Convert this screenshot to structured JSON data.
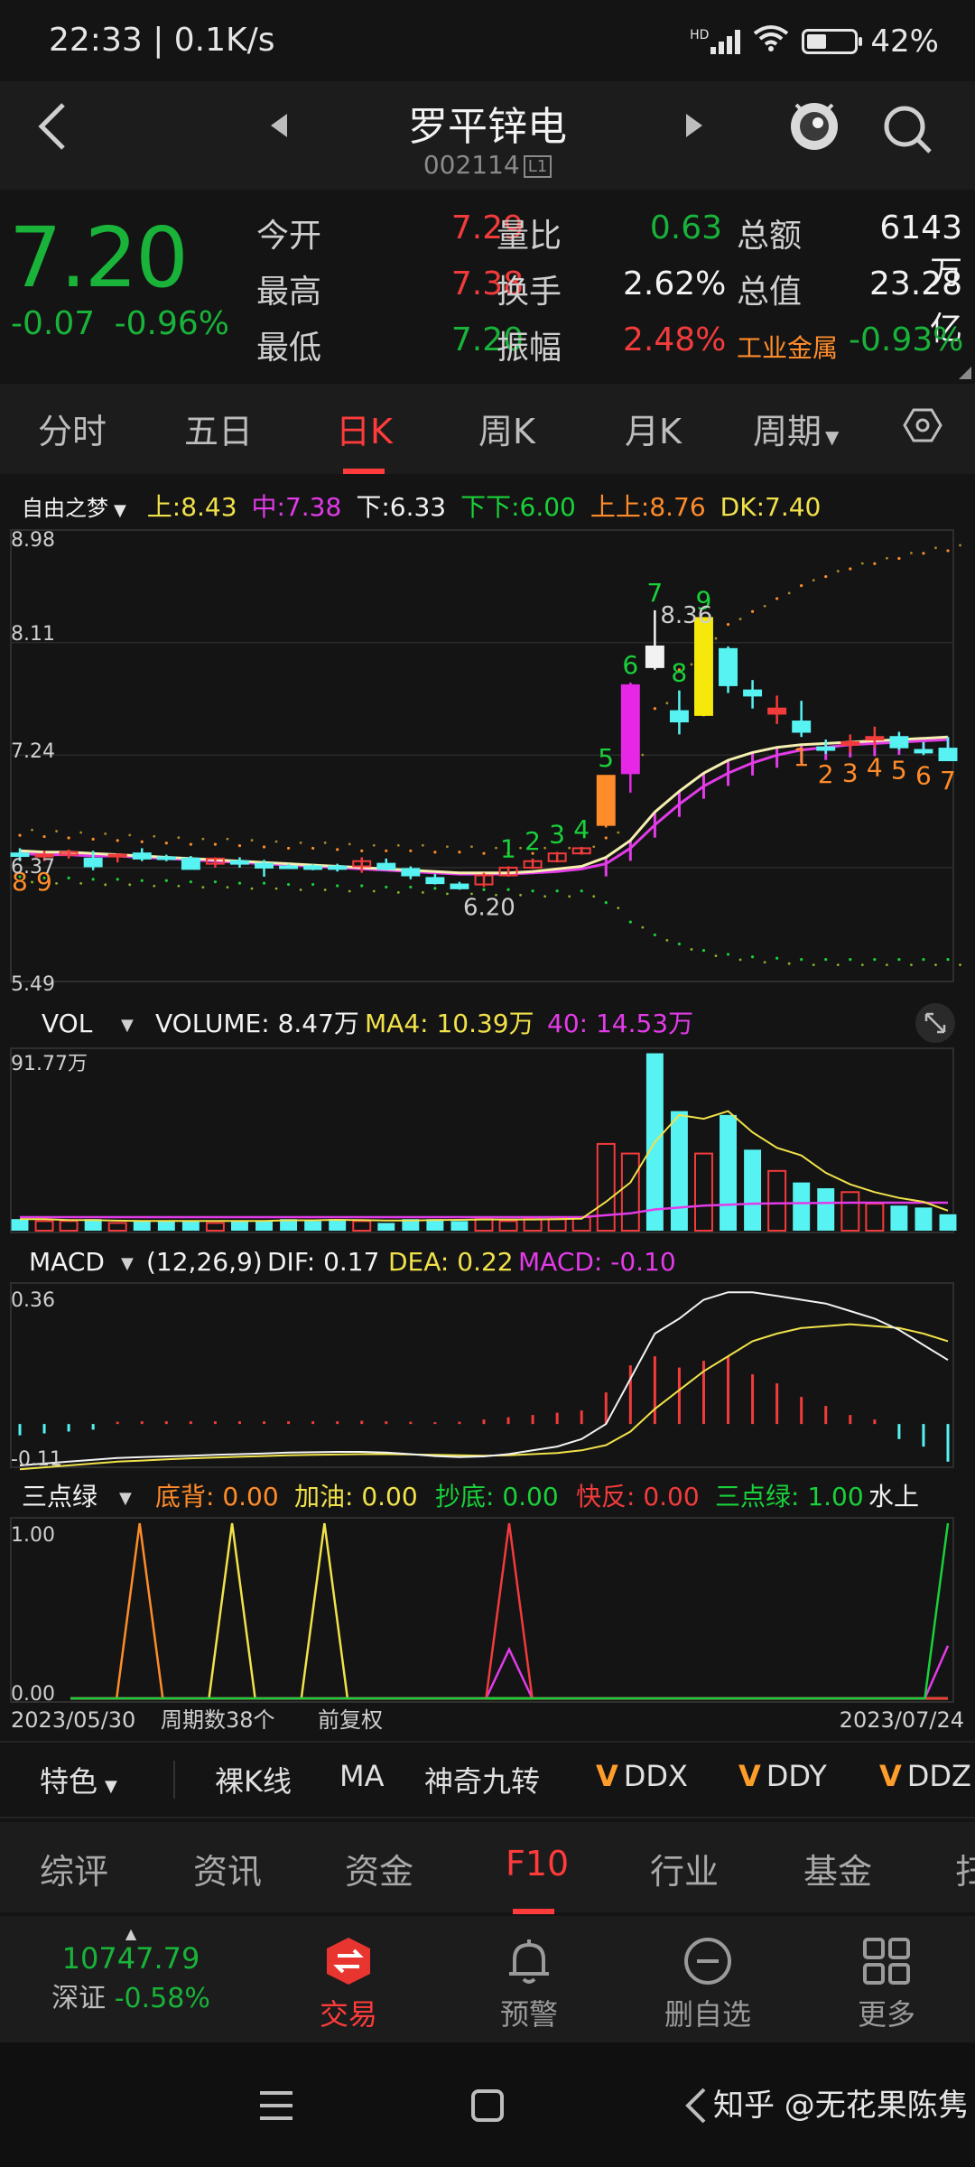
{
  "status": {
    "time_speed": "22:33 | 0.1K/s",
    "network_tag": "HD",
    "battery_pct": "42%",
    "battery_level": 0.42
  },
  "header": {
    "stock_name": "罗平锌电",
    "stock_code": "002114",
    "level_tag": "L1",
    "icons": {
      "back": "back-chevron-icon",
      "prev": "prev-triangle-icon",
      "next": "next-triangle-icon",
      "mascot": "mascot-icon",
      "search": "search-icon"
    }
  },
  "quote": {
    "price": "7.20",
    "change": "-0.07",
    "change_pct": "-0.96%",
    "rows": [
      {
        "l1": "今开",
        "v1": "7.29",
        "c1": "red",
        "l2": "量比",
        "v2": "0.63",
        "c2": "green",
        "l3": "总额",
        "v3": "6143万",
        "c3": "white"
      },
      {
        "l1": "最高",
        "v1": "7.38",
        "c1": "red",
        "l2": "换手",
        "v2": "2.62%",
        "c2": "white",
        "l3": "总值",
        "v3": "23.28亿",
        "c3": "white"
      },
      {
        "l1": "最低",
        "v1": "7.20",
        "c1": "green",
        "l2": "振幅",
        "v2": "2.48%",
        "c2": "red",
        "l3": "工业金属",
        "v3": "-0.93%",
        "c3": "green"
      }
    ]
  },
  "period_tabs": [
    "分时",
    "五日",
    "日K",
    "周K",
    "月K",
    "周期"
  ],
  "active_period": "日K",
  "indicator_legend": {
    "name": "自由之梦",
    "items": [
      {
        "label": "上:",
        "value": "8.43",
        "color": "#f1e24a"
      },
      {
        "label": "中:",
        "value": "7.38",
        "color": "#e23be8"
      },
      {
        "label": "下:",
        "value": "6.33",
        "color": "#f2f2f2"
      },
      {
        "label": "下下:",
        "value": "6.00",
        "color": "#19d13a"
      },
      {
        "label": "上上:",
        "value": "8.76",
        "color": "#ff8c2a"
      },
      {
        "label": "DK:",
        "value": "7.40",
        "color": "#f1e24a"
      }
    ]
  },
  "main_axis": {
    "top": "8.98",
    "y2": "8.11",
    "y3": "7.24",
    "y4": "6.37",
    "bottom": "5.49"
  },
  "main_annotations": {
    "high_label": "8.36",
    "low_label": "6.20"
  },
  "vol_legend": {
    "name": "VOL",
    "volume": "VOLUME: 8.47万",
    "ma4": "MA4: 10.39万",
    "ma40": "40: 14.53万",
    "max": "91.77万"
  },
  "macd_legend": {
    "name": "MACD",
    "params": "(12,26,9)",
    "dif": "DIF: 0.17",
    "dea": "DEA: 0.22",
    "macd": "MACD: -0.10",
    "top": "0.36",
    "bottom": "-0.11"
  },
  "sdl_legend": {
    "name": "三点绿",
    "items": [
      {
        "text": "底背: 0.00",
        "color": "#ff8c2a"
      },
      {
        "text": "加油: 0.00",
        "color": "#f1e24a"
      },
      {
        "text": "抄底: 0.00",
        "color": "#19d13a"
      },
      {
        "text": "快反: 0.00",
        "color": "#f23b3b"
      },
      {
        "text": "三点绿: 1.00",
        "color": "#19d13a"
      },
      {
        "text": "水上",
        "color": "#f2f2f2"
      }
    ],
    "top": "1.00",
    "bottom": "0.00"
  },
  "date_row": {
    "start": "2023/05/30",
    "period_count": "周期数38个",
    "adjust": "前复权",
    "end": "2023/07/24"
  },
  "tools": {
    "special": "特色",
    "items": [
      "裸K线",
      "MA",
      "神奇九转",
      "DDX",
      "DDY",
      "DDZ"
    ]
  },
  "info_tabs": [
    "综评",
    "资讯",
    "资金",
    "F10",
    "行业",
    "基金",
    "扫"
  ],
  "active_info_tab": "F10",
  "bottom_nav": {
    "index_value": "10747.79",
    "index_name": "深证",
    "index_change": "-0.58%",
    "items": [
      {
        "label": "交易",
        "icon": "trade-icon"
      },
      {
        "label": "预警",
        "icon": "bell-icon"
      },
      {
        "label": "删自选",
        "icon": "remove-favorite-icon"
      },
      {
        "label": "更多",
        "icon": "grid-icon"
      }
    ]
  },
  "watermark": "知乎 @无花果陈隽",
  "chart_data": {
    "type": "candlestick",
    "candles": [
      {
        "o": 6.48,
        "h": 6.52,
        "l": 6.42,
        "c": 6.46
      },
      {
        "o": 6.46,
        "h": 6.5,
        "l": 6.42,
        "c": 6.47
      },
      {
        "o": 6.47,
        "h": 6.51,
        "l": 6.44,
        "c": 6.49
      },
      {
        "o": 6.44,
        "h": 6.5,
        "l": 6.35,
        "c": 6.38
      },
      {
        "o": 6.46,
        "h": 6.48,
        "l": 6.41,
        "c": 6.47
      },
      {
        "o": 6.48,
        "h": 6.52,
        "l": 6.42,
        "c": 6.44
      },
      {
        "o": 6.45,
        "h": 6.47,
        "l": 6.42,
        "c": 6.44
      },
      {
        "o": 6.44,
        "h": 6.46,
        "l": 6.36,
        "c": 6.36
      },
      {
        "o": 6.4,
        "h": 6.45,
        "l": 6.37,
        "c": 6.44
      },
      {
        "o": 6.42,
        "h": 6.45,
        "l": 6.37,
        "c": 6.4
      },
      {
        "o": 6.4,
        "h": 6.43,
        "l": 6.3,
        "c": 6.37
      },
      {
        "o": 6.38,
        "h": 6.4,
        "l": 6.36,
        "c": 6.37
      },
      {
        "o": 6.38,
        "h": 6.4,
        "l": 6.35,
        "c": 6.36
      },
      {
        "o": 6.38,
        "h": 6.4,
        "l": 6.34,
        "c": 6.36
      },
      {
        "o": 6.38,
        "h": 6.45,
        "l": 6.33,
        "c": 6.42
      },
      {
        "o": 6.4,
        "h": 6.44,
        "l": 6.35,
        "c": 6.36
      },
      {
        "o": 6.36,
        "h": 6.38,
        "l": 6.28,
        "c": 6.31
      },
      {
        "o": 6.29,
        "h": 6.32,
        "l": 6.24,
        "c": 6.25
      },
      {
        "o": 6.24,
        "h": 6.26,
        "l": 6.2,
        "c": 6.21
      },
      {
        "o": 6.24,
        "h": 6.33,
        "l": 6.22,
        "c": 6.31
      },
      {
        "o": 6.31,
        "h": 6.38,
        "l": 6.3,
        "c": 6.37
      },
      {
        "o": 6.37,
        "h": 6.44,
        "l": 6.36,
        "c": 6.42
      },
      {
        "o": 6.42,
        "h": 6.49,
        "l": 6.41,
        "c": 6.48
      },
      {
        "o": 6.48,
        "h": 6.53,
        "l": 6.47,
        "c": 6.52
      },
      {
        "o": 6.7,
        "h": 7.08,
        "l": 6.68,
        "c": 7.08
      },
      {
        "o": 7.1,
        "h": 7.8,
        "l": 6.95,
        "c": 7.78
      },
      {
        "o": 8.08,
        "h": 8.36,
        "l": 7.9,
        "c": 7.92
      },
      {
        "o": 7.58,
        "h": 7.74,
        "l": 7.4,
        "c": 7.5
      },
      {
        "o": 7.55,
        "h": 8.3,
        "l": 7.54,
        "c": 8.3
      },
      {
        "o": 8.06,
        "h": 8.08,
        "l": 7.72,
        "c": 7.78
      },
      {
        "o": 7.74,
        "h": 7.82,
        "l": 7.6,
        "c": 7.7
      },
      {
        "o": 7.56,
        "h": 7.7,
        "l": 7.48,
        "c": 7.6
      },
      {
        "o": 7.5,
        "h": 7.66,
        "l": 7.38,
        "c": 7.42
      },
      {
        "o": 7.3,
        "h": 7.36,
        "l": 7.25,
        "c": 7.28
      },
      {
        "o": 7.32,
        "h": 7.4,
        "l": 7.26,
        "c": 7.34
      },
      {
        "o": 7.36,
        "h": 7.46,
        "l": 7.3,
        "c": 7.38
      },
      {
        "o": 7.38,
        "h": 7.42,
        "l": 7.28,
        "c": 7.3
      },
      {
        "o": 7.28,
        "h": 7.34,
        "l": 7.24,
        "c": 7.26
      },
      {
        "o": 7.29,
        "h": 7.38,
        "l": 7.2,
        "c": 7.2
      }
    ],
    "ma_yellow": [
      6.5,
      6.49,
      6.49,
      6.48,
      6.47,
      6.46,
      6.45,
      6.44,
      6.43,
      6.42,
      6.41,
      6.4,
      6.39,
      6.38,
      6.37,
      6.36,
      6.35,
      6.34,
      6.33,
      6.33,
      6.33,
      6.34,
      6.36,
      6.38,
      6.45,
      6.58,
      6.8,
      6.96,
      7.1,
      7.2,
      7.26,
      7.3,
      7.32,
      7.33,
      7.34,
      7.35,
      7.36,
      7.37,
      7.38
    ],
    "ma_magenta": [
      6.48,
      6.47,
      6.47,
      6.46,
      6.46,
      6.45,
      6.44,
      6.43,
      6.42,
      6.41,
      6.4,
      6.39,
      6.38,
      6.37,
      6.36,
      6.35,
      6.34,
      6.33,
      6.32,
      6.32,
      6.32,
      6.33,
      6.34,
      6.36,
      6.4,
      6.52,
      6.7,
      6.86,
      7.0,
      7.1,
      7.18,
      7.24,
      7.28,
      7.3,
      7.32,
      7.33,
      7.34,
      7.35,
      7.36
    ],
    "upper_dots": [
      6.62,
      6.61,
      6.6,
      6.59,
      6.58,
      6.57,
      6.56,
      6.55,
      6.55,
      6.54,
      6.53,
      6.52,
      6.52,
      6.51,
      6.5,
      6.5,
      6.5,
      6.49,
      6.49,
      6.48,
      6.48,
      6.48,
      6.48,
      6.49,
      6.6,
      7.2,
      7.6,
      7.9,
      8.1,
      8.25,
      8.35,
      8.45,
      8.55,
      8.62,
      8.68,
      8.72,
      8.76,
      8.8,
      8.82
    ],
    "lower_dots": [
      6.3,
      6.29,
      6.29,
      6.28,
      6.28,
      6.27,
      6.27,
      6.26,
      6.26,
      6.25,
      6.25,
      6.24,
      6.24,
      6.23,
      6.23,
      6.22,
      6.22,
      6.21,
      6.21,
      6.2,
      6.2,
      6.19,
      6.19,
      6.19,
      6.1,
      5.95,
      5.85,
      5.78,
      5.73,
      5.7,
      5.68,
      5.67,
      5.66,
      5.66,
      5.66,
      5.66,
      5.66,
      5.66,
      5.66
    ],
    "nine_counts": [
      {
        "i": 0,
        "t": "8",
        "color": "#ff8c2a",
        "pos": "below"
      },
      {
        "i": 1,
        "t": "9",
        "color": "#ff8c2a",
        "pos": "below"
      },
      {
        "i": 20,
        "t": "1",
        "color": "#19d13a",
        "pos": "above"
      },
      {
        "i": 21,
        "t": "2",
        "color": "#19d13a",
        "pos": "above"
      },
      {
        "i": 22,
        "t": "3",
        "color": "#19d13a",
        "pos": "above"
      },
      {
        "i": 23,
        "t": "4",
        "color": "#19d13a",
        "pos": "above"
      },
      {
        "i": 24,
        "t": "5",
        "color": "#19d13a",
        "pos": "above"
      },
      {
        "i": 25,
        "t": "6",
        "color": "#19d13a",
        "pos": "above"
      },
      {
        "i": 26,
        "t": "7",
        "color": "#19d13a",
        "pos": "above"
      },
      {
        "i": 27,
        "t": "8",
        "color": "#19d13a",
        "pos": "above"
      },
      {
        "i": 28,
        "t": "9",
        "color": "#19d13a",
        "pos": "above"
      },
      {
        "i": 32,
        "t": "1",
        "color": "#ff8c2a",
        "pos": "below"
      },
      {
        "i": 33,
        "t": "2",
        "color": "#ff8c2a",
        "pos": "below"
      },
      {
        "i": 34,
        "t": "3",
        "color": "#ff8c2a",
        "pos": "below"
      },
      {
        "i": 35,
        "t": "4",
        "color": "#ff8c2a",
        "pos": "below"
      },
      {
        "i": 36,
        "t": "5",
        "color": "#ff8c2a",
        "pos": "below"
      },
      {
        "i": 37,
        "t": "6",
        "color": "#ff8c2a",
        "pos": "below"
      },
      {
        "i": 38,
        "t": "7",
        "color": "#ff8c2a",
        "pos": "below"
      }
    ],
    "volume": [
      6,
      5,
      5,
      6,
      4,
      5,
      5,
      5,
      4,
      5,
      5,
      6,
      5,
      6,
      5,
      4,
      6,
      6,
      5,
      6,
      5,
      6,
      6,
      7,
      45,
      40,
      92,
      62,
      40,
      60,
      42,
      31,
      25,
      22,
      20,
      14,
      13,
      12,
      8.5
    ],
    "volume_ma4": [
      6,
      6,
      5.5,
      5.5,
      5.2,
      5,
      5,
      5,
      5,
      5,
      5,
      5.4,
      5.4,
      5.6,
      5.5,
      5.3,
      5.3,
      5.5,
      5.6,
      5.8,
      5.8,
      5.8,
      6,
      6.2,
      15,
      25,
      46,
      60,
      58,
      62,
      51,
      43,
      39,
      30,
      24,
      20,
      17,
      15,
      10.4
    ],
    "volume_ma40": [
      7,
      7,
      7,
      7,
      7,
      7,
      7,
      7,
      7,
      7,
      7,
      7,
      7,
      7,
      7,
      7,
      7,
      7,
      7,
      7,
      7,
      7,
      7,
      7,
      8,
      9,
      11,
      12,
      13,
      13.5,
      14,
      14.2,
      14.3,
      14.4,
      14.5,
      14.5,
      14.5,
      14.5,
      14.5
    ],
    "vol_ymax": 91.77,
    "macd_hist": [
      -0.03,
      -0.025,
      -0.02,
      -0.015,
      0.01,
      0.012,
      0.012,
      0.012,
      0.012,
      0.012,
      0.012,
      0.012,
      0.012,
      0.012,
      0.014,
      0.012,
      0.01,
      0.008,
      0.01,
      0.02,
      0.03,
      0.04,
      0.05,
      0.06,
      0.14,
      0.26,
      0.3,
      0.25,
      0.28,
      0.3,
      0.22,
      0.18,
      0.12,
      0.08,
      0.04,
      0.02,
      -0.04,
      -0.06,
      -0.1
    ],
    "macd_dif": [
      -0.11,
      -0.105,
      -0.1,
      -0.095,
      -0.09,
      -0.088,
      -0.086,
      -0.084,
      -0.082,
      -0.08,
      -0.078,
      -0.076,
      -0.075,
      -0.074,
      -0.074,
      -0.076,
      -0.08,
      -0.085,
      -0.088,
      -0.086,
      -0.08,
      -0.07,
      -0.06,
      -0.04,
      0.0,
      0.12,
      0.24,
      0.28,
      0.33,
      0.35,
      0.35,
      0.34,
      0.33,
      0.32,
      0.3,
      0.28,
      0.25,
      0.21,
      0.17
    ],
    "macd_dea": [
      -0.12,
      -0.115,
      -0.11,
      -0.105,
      -0.1,
      -0.097,
      -0.094,
      -0.091,
      -0.089,
      -0.087,
      -0.085,
      -0.083,
      -0.082,
      -0.081,
      -0.08,
      -0.08,
      -0.081,
      -0.082,
      -0.083,
      -0.084,
      -0.083,
      -0.08,
      -0.077,
      -0.07,
      -0.056,
      -0.02,
      0.04,
      0.09,
      0.14,
      0.18,
      0.22,
      0.24,
      0.255,
      0.26,
      0.265,
      0.26,
      0.255,
      0.24,
      0.22
    ],
    "macd_range": [
      -0.11,
      0.36
    ],
    "sdl_orange": [
      0,
      0,
      0,
      1,
      0,
      0,
      0,
      0,
      0,
      0,
      0,
      0,
      0,
      0,
      0,
      0,
      0,
      0,
      0,
      0,
      0,
      0,
      0,
      0,
      0,
      0,
      0,
      0,
      0,
      0,
      0,
      0,
      0,
      0,
      0,
      0,
      0,
      0,
      0
    ],
    "sdl_yellow": [
      0,
      0,
      0,
      0,
      0,
      0,
      0,
      1,
      0,
      0,
      0,
      1,
      0,
      0,
      0,
      0,
      0,
      0,
      0,
      0,
      0,
      0,
      0,
      0,
      0,
      0,
      0,
      0,
      0,
      0,
      0,
      0,
      0,
      0,
      0,
      0,
      0,
      0,
      0
    ],
    "sdl_red": [
      0,
      0,
      0,
      0,
      0,
      0,
      0,
      0,
      0,
      0,
      0,
      0,
      0,
      0,
      0,
      0,
      0,
      0,
      0,
      1,
      0,
      0,
      0,
      0,
      0,
      0,
      0,
      0,
      0,
      0,
      0,
      0,
      0,
      0,
      0,
      0,
      0,
      0,
      0
    ],
    "sdl_magenta": [
      0,
      0,
      0,
      0,
      0,
      0,
      0,
      0,
      0,
      0,
      0,
      0,
      0,
      0,
      0,
      0,
      0,
      0,
      0,
      0.28,
      0,
      0,
      0,
      0,
      0,
      0,
      0,
      0,
      0,
      0,
      0,
      0,
      0,
      0,
      0,
      0,
      0,
      0,
      0.3
    ],
    "sdl_green": [
      0,
      0,
      0,
      0,
      0,
      0,
      0,
      0,
      0,
      0,
      0,
      0,
      0,
      0,
      0,
      0,
      0,
      0,
      0,
      0,
      0,
      0,
      0,
      0,
      0,
      0,
      0,
      0,
      0,
      0,
      0,
      0,
      0,
      0,
      0,
      0,
      0,
      0,
      1
    ]
  }
}
